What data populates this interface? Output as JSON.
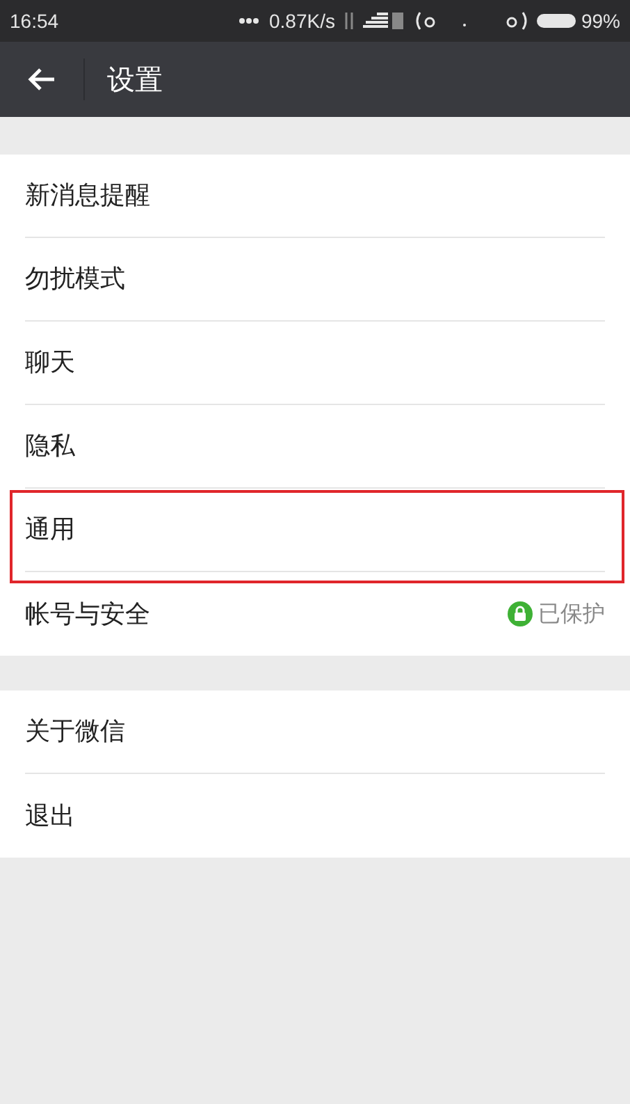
{
  "status_bar": {
    "time": "16:54",
    "speed": "0.87K/s",
    "battery": "99%"
  },
  "header": {
    "title": "设置"
  },
  "groups": [
    {
      "items": [
        {
          "label": "新消息提醒",
          "highlighted": false
        },
        {
          "label": "勿扰模式",
          "highlighted": false
        },
        {
          "label": "聊天",
          "highlighted": false
        },
        {
          "label": "隐私",
          "highlighted": false
        },
        {
          "label": "通用",
          "highlighted": true
        },
        {
          "label": "帐号与安全",
          "highlighted": false,
          "status": "已保护"
        }
      ]
    },
    {
      "items": [
        {
          "label": "关于微信",
          "highlighted": false
        },
        {
          "label": "退出",
          "highlighted": false
        }
      ]
    }
  ]
}
